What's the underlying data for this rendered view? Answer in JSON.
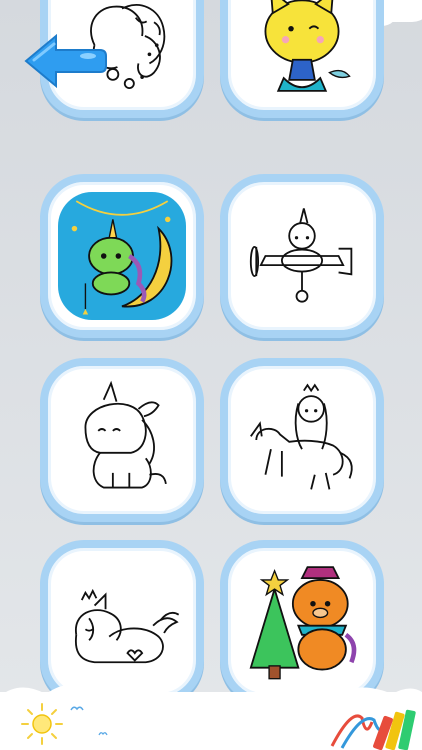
{
  "app": {
    "screen": "coloring-page-picker"
  },
  "colors": {
    "tile_border": "#a8d3f4",
    "tile_bg": "#ffffff",
    "back_arrow": "#2f9df0",
    "background": "#dfe2e6"
  },
  "toolbar": {
    "back_icon": "back-arrow-icon"
  },
  "tiles": [
    {
      "id": "unicorn-head",
      "icon": "unicorn-head-outline"
    },
    {
      "id": "cat-mermaid",
      "icon": "cat-mermaid-colored"
    },
    {
      "id": "unicorn-moon",
      "icon": "unicorn-on-moon-colored"
    },
    {
      "id": "unicorn-airplane",
      "icon": "unicorn-airplane-outline"
    },
    {
      "id": "sitting-unicorn",
      "icon": "sitting-unicorn-outline"
    },
    {
      "id": "princess-unicorn",
      "icon": "princess-riding-unicorn-outline"
    },
    {
      "id": "sleeping-unicorn",
      "icon": "sleeping-unicorn-outline"
    },
    {
      "id": "bear-tree",
      "icon": "bear-with-tree-colored"
    }
  ],
  "bottom_bar": {
    "left_icon": "sun-icon",
    "right_icon": "crayons-icon"
  }
}
